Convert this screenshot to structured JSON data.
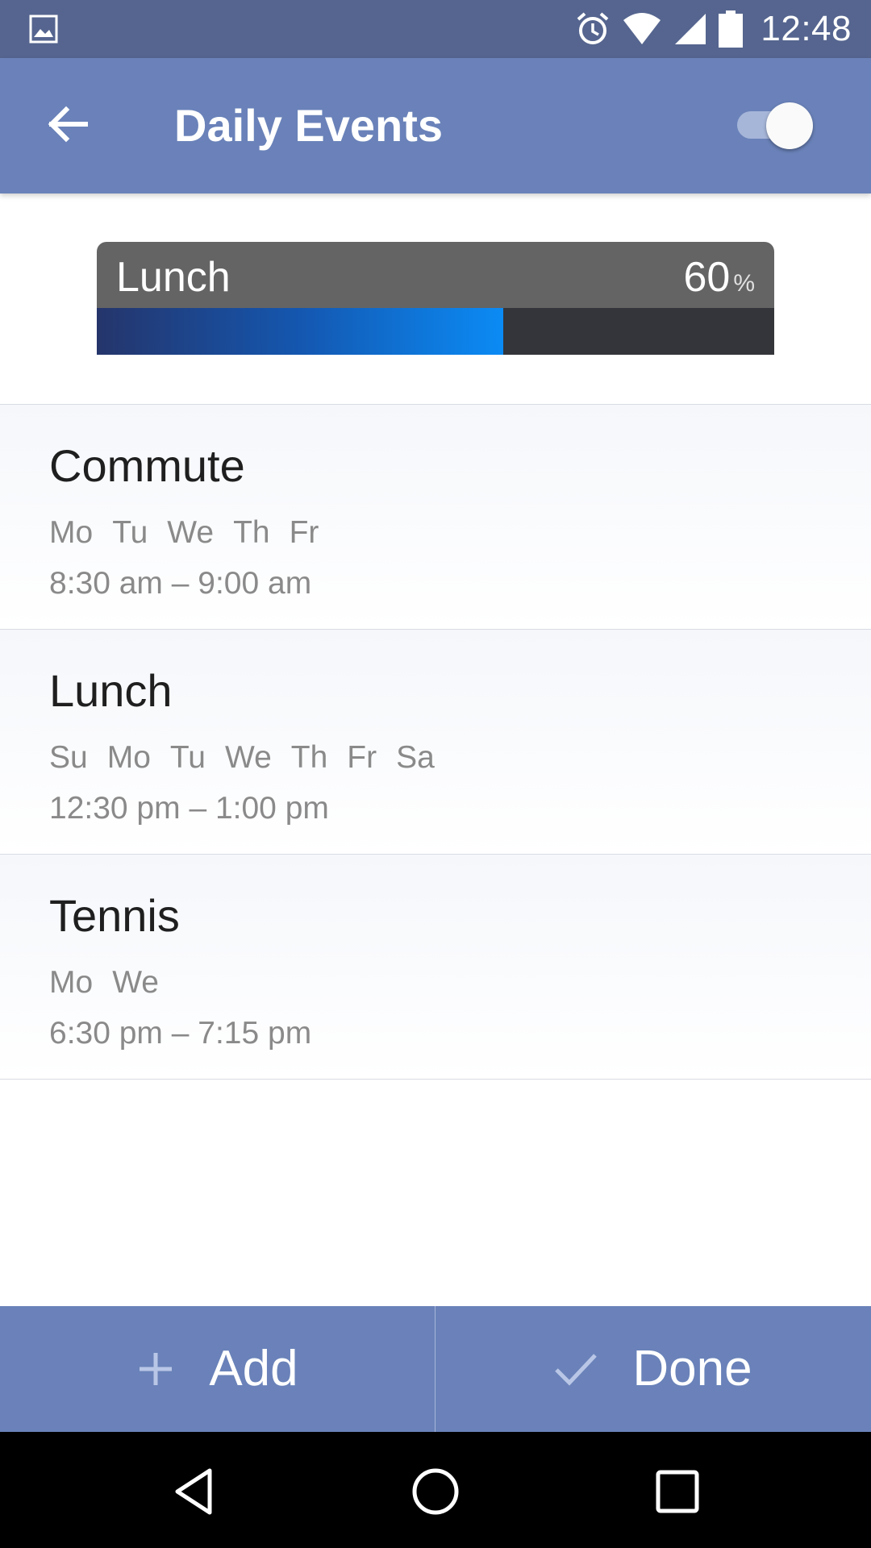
{
  "status_bar": {
    "time": "12:48",
    "icons": [
      "image-icon",
      "alarm-icon",
      "wifi-icon",
      "signal-icon",
      "battery-icon"
    ]
  },
  "app_bar": {
    "title": "Daily Events",
    "toggle_on": true,
    "colors": {
      "bar": "#6a82b9",
      "status": "#55658f"
    }
  },
  "progress": {
    "label": "Lunch",
    "value": "60",
    "unit": "%",
    "fraction": 0.6
  },
  "events": [
    {
      "name": "Commute",
      "days": [
        "Mo",
        "Tu",
        "We",
        "Th",
        "Fr"
      ],
      "time": "8:30 am – 9:00 am"
    },
    {
      "name": "Lunch",
      "days": [
        "Su",
        "Mo",
        "Tu",
        "We",
        "Th",
        "Fr",
        "Sa"
      ],
      "time": "12:30 pm – 1:00 pm"
    },
    {
      "name": "Tennis",
      "days": [
        "Mo",
        "We"
      ],
      "time": "6:30 pm – 7:15 pm"
    }
  ],
  "actions": {
    "add_label": "Add",
    "done_label": "Done"
  },
  "nav": [
    "back-nav-icon",
    "home-nav-icon",
    "recents-nav-icon"
  ]
}
